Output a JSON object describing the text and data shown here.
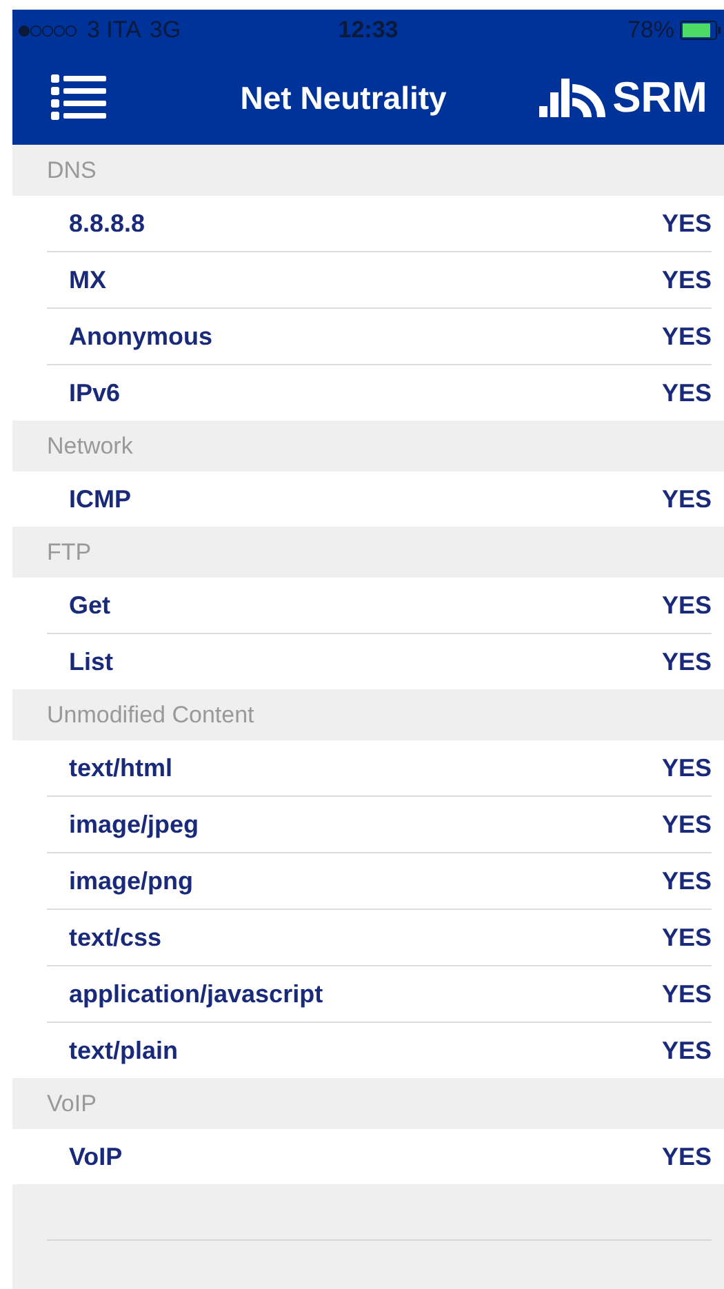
{
  "status_bar": {
    "carrier": "3 ITA",
    "network": "3G",
    "time": "12:33",
    "battery": "78%"
  },
  "nav_bar": {
    "title": "Net Neutrality",
    "logo": "SRM"
  },
  "sections": [
    {
      "title": "DNS",
      "rows": [
        {
          "label": "8.8.8.8",
          "value": "YES"
        },
        {
          "label": "MX",
          "value": "YES"
        },
        {
          "label": "Anonymous",
          "value": "YES"
        },
        {
          "label": "IPv6",
          "value": "YES"
        }
      ]
    },
    {
      "title": "Network",
      "rows": [
        {
          "label": "ICMP",
          "value": "YES"
        }
      ]
    },
    {
      "title": "FTP",
      "rows": [
        {
          "label": "Get",
          "value": "YES"
        },
        {
          "label": "List",
          "value": "YES"
        }
      ]
    },
    {
      "title": "Unmodified Content",
      "rows": [
        {
          "label": "text/html",
          "value": "YES"
        },
        {
          "label": "image/jpeg",
          "value": "YES"
        },
        {
          "label": "image/png",
          "value": "YES"
        },
        {
          "label": "text/css",
          "value": "YES"
        },
        {
          "label": "application/javascript",
          "value": "YES"
        },
        {
          "label": "text/plain",
          "value": "YES"
        }
      ]
    },
    {
      "title": "VoIP",
      "rows": [
        {
          "label": "VoIP",
          "value": "YES"
        }
      ]
    }
  ]
}
